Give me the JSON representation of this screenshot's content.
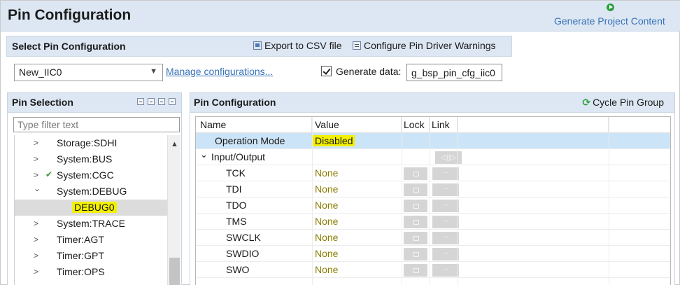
{
  "header": {
    "title": "Pin Configuration",
    "generate_link": "Generate Project Content"
  },
  "select_section": {
    "title": "Select Pin Configuration",
    "export_label": "Export to CSV file",
    "warnings_label": "Configure Pin Driver Warnings",
    "selected_config": "New_IIC0",
    "manage_link": "Manage configurations...",
    "generate_data_label": "Generate data:",
    "generate_data_checked": true,
    "generate_data_value": "g_bsp_pin_cfg_iic0"
  },
  "pin_selection": {
    "title": "Pin Selection",
    "filter_placeholder": "Type filter text",
    "tree": [
      {
        "label": "Storage:SDHI",
        "arrow": ">",
        "checked": false
      },
      {
        "label": "System:BUS",
        "arrow": ">",
        "checked": false
      },
      {
        "label": "System:CGC",
        "arrow": ">",
        "checked": true
      },
      {
        "label": "System:DEBUG",
        "arrow": "⌄",
        "checked": false
      },
      {
        "label": "DEBUG0",
        "arrow": "",
        "checked": false,
        "selected": true,
        "highlighted": true
      },
      {
        "label": "System:TRACE",
        "arrow": ">",
        "checked": false
      },
      {
        "label": "Timer:AGT",
        "arrow": ">",
        "checked": false
      },
      {
        "label": "Timer:GPT",
        "arrow": ">",
        "checked": false
      },
      {
        "label": "Timer:OPS",
        "arrow": ">",
        "checked": false
      }
    ]
  },
  "pin_config": {
    "title": "Pin Configuration",
    "cycle_label": "Cycle Pin Group",
    "columns": [
      "Name",
      "Value",
      "Lock",
      "Link"
    ],
    "operation_mode": {
      "name": "Operation Mode",
      "value": "Disabled"
    },
    "group": {
      "name": "Input/Output",
      "arrow": "⌄"
    },
    "pins": [
      {
        "name": "TCK",
        "value": "None"
      },
      {
        "name": "TDI",
        "value": "None"
      },
      {
        "name": "TDO",
        "value": "None"
      },
      {
        "name": "TMS",
        "value": "None"
      },
      {
        "name": "SWCLK",
        "value": "None"
      },
      {
        "name": "SWDIO",
        "value": "None"
      },
      {
        "name": "SWO",
        "value": "None"
      }
    ]
  },
  "colors": {
    "header_bg": "#dde7f3",
    "link": "#3772b8",
    "highlight": "#f3f000",
    "selected_row": "#cce4f7",
    "none_value": "#8a7d00"
  }
}
